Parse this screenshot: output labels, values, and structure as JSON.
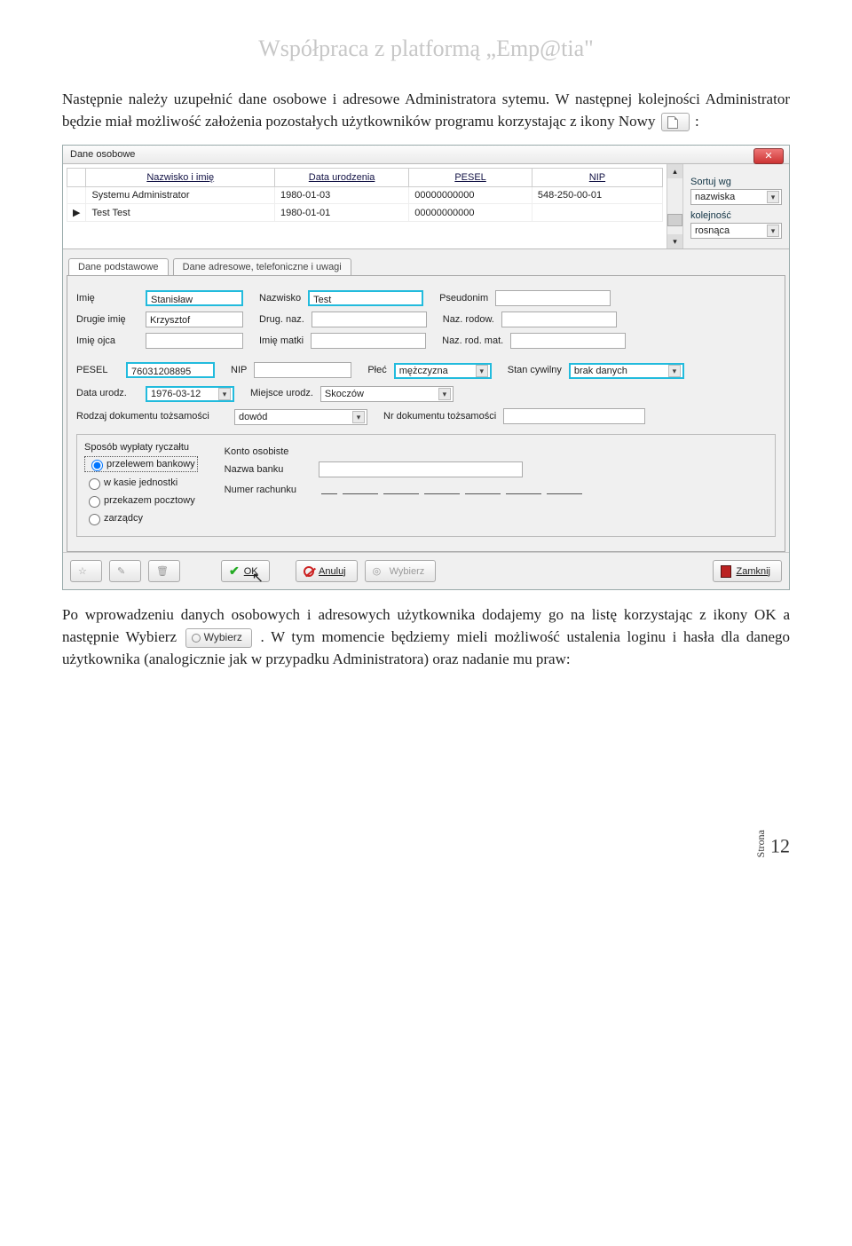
{
  "doc_title": "Współpraca z platformą „Emp@tia\"",
  "para1_a": "Następnie należy uzupełnić dane osobowe i adresowe Administratora sytemu. W następnej kolejności Administrator będzie miał możliwość założenia pozostałych użytkowników programu korzystając z ikony Nowy ",
  "para1_b": ":",
  "para2_a": "Po wprowadzeniu danych osobowych i adresowych użytkownika dodajemy go na listę korzystając z ikony OK a następnie Wybierz ",
  "para2_b": ". W tym momencie będziemy mieli możliwość ustalenia loginu i hasła dla danego użytkownika (analogicznie jak w przypadku Administratora) oraz nadanie mu praw:",
  "inline_wybierz": "Wybierz",
  "window": {
    "title": "Dane osobowe",
    "grid": {
      "headers": [
        "Nazwisko i imię",
        "Data urodzenia",
        "PESEL",
        "NIP"
      ],
      "rows": [
        {
          "mark": "",
          "name": "Systemu Administrator",
          "dob": "1980-01-03",
          "pesel": "00000000000",
          "nip": "548-250-00-01"
        },
        {
          "mark": "▶",
          "name": "Test Test",
          "dob": "1980-01-01",
          "pesel": "00000000000",
          "nip": ""
        }
      ]
    },
    "sort": {
      "label1": "Sortuj wg",
      "value1": "nazwiska",
      "label2": "kolejność",
      "value2": "rosnąca"
    },
    "tabs": {
      "t1": "Dane podstawowe",
      "t2": "Dane adresowe, telefoniczne i uwagi"
    },
    "form": {
      "imie_l": "Imię",
      "imie": "Stanisław",
      "nazw_l": "Nazwisko",
      "nazw": "Test",
      "pseud_l": "Pseudonim",
      "drugie_l": "Drugie imię",
      "drugie": "Krzysztof",
      "drugnaz_l": "Drug. naz.",
      "nazrodow_l": "Naz. rodow.",
      "imieojca_l": "Imię ojca",
      "imiematki_l": "Imię matki",
      "nazrodmat_l": "Naz. rod. mat.",
      "pesel_l": "PESEL",
      "pesel": "76031208895",
      "nip_l": "NIP",
      "plec_l": "Płeć",
      "plec": "mężczyzna",
      "stan_l": "Stan cywilny",
      "stan": "brak danych",
      "dataur_l": "Data urodz.",
      "dataur": "1976-03-12",
      "miejsce_l": "Miejsce urodz.",
      "miejsce": "Skoczów",
      "rodzdok_l": "Rodzaj dokumentu tożsamości",
      "rodzdok": "dowód",
      "nrdok_l": "Nr dokumentu tożsamości",
      "sposob_l": "Sposób wypłaty ryczałtu",
      "r1": "przelewem bankowy",
      "r2": "w kasie jednostki",
      "r3": "przekazem pocztowy",
      "r4": "zarządcy",
      "konto_l": "Konto osobiste",
      "bank_l": "Nazwa banku",
      "rach_l": "Numer rachunku"
    },
    "buttons": {
      "ok": "OK",
      "anuluj": "Anuluj",
      "wybierz": "Wybierz",
      "zamknij": "Zamknij"
    }
  },
  "footer": {
    "label": "Strona",
    "num": "12"
  }
}
